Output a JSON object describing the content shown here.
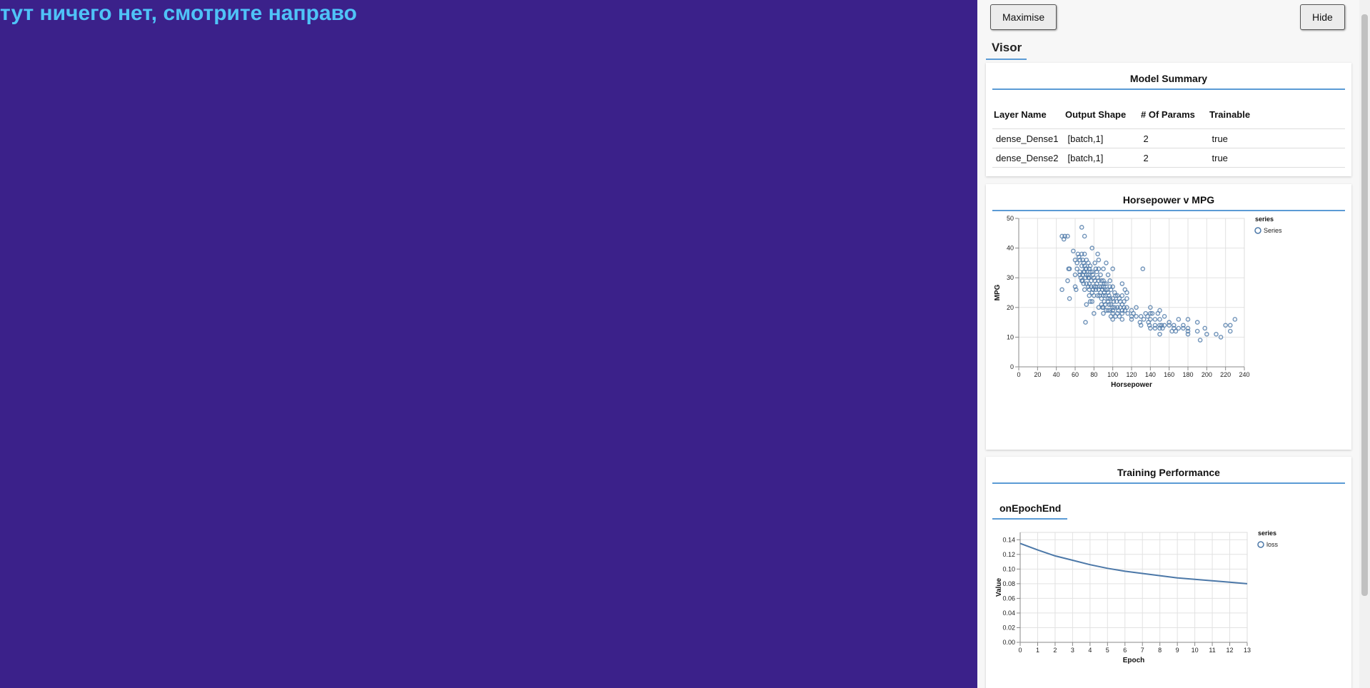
{
  "main": {
    "heading": "тут ничего нет, смотрите направо"
  },
  "visor": {
    "maximise_label": "Maximise",
    "hide_label": "Hide",
    "tab_label": "Visor",
    "summary": {
      "title": "Model Summary",
      "headers": [
        "Layer Name",
        "Output Shape",
        "# Of Params",
        "Trainable"
      ],
      "rows": [
        [
          "dense_Dense1",
          "[batch,1]",
          "2",
          "true"
        ],
        [
          "dense_Dense2",
          "[batch,1]",
          "2",
          "true"
        ]
      ]
    },
    "hp_title": "Horsepower v MPG",
    "training": {
      "title": "Training Performance",
      "tab_label": "onEpochEnd"
    }
  },
  "chart_data": [
    {
      "type": "scatter",
      "title": "Horsepower v MPG",
      "xlabel": "Horsepower",
      "ylabel": "MPG",
      "xlim": [
        0,
        240
      ],
      "ylim": [
        0,
        50
      ],
      "x_ticks": [
        "0",
        "20",
        "40",
        "60",
        "80",
        "100",
        "120",
        "140",
        "160",
        "180",
        "200",
        "220",
        "240"
      ],
      "y_ticks": [
        "0",
        "10",
        "20",
        "30",
        "40",
        "50"
      ],
      "legend_title": "series",
      "legend_position": "top-right",
      "grid": true,
      "color": "#4c78a8",
      "series": [
        {
          "name": "Series",
          "points": [
            [
              46,
              26
            ],
            [
              46,
              44
            ],
            [
              48,
              43
            ],
            [
              49,
              44
            ],
            [
              52,
              44
            ],
            [
              52,
              29
            ],
            [
              53,
              33
            ],
            [
              54,
              33
            ],
            [
              54,
              23
            ],
            [
              58,
              39
            ],
            [
              60,
              36
            ],
            [
              60,
              31
            ],
            [
              60,
              27
            ],
            [
              61,
              26
            ],
            [
              62,
              35
            ],
            [
              62,
              33
            ],
            [
              63,
              38
            ],
            [
              64,
              37
            ],
            [
              65,
              31
            ],
            [
              65,
              36
            ],
            [
              65,
              32
            ],
            [
              66,
              30
            ],
            [
              67,
              47
            ],
            [
              67,
              38
            ],
            [
              67,
              34
            ],
            [
              67,
              29
            ],
            [
              68,
              36
            ],
            [
              68,
              31
            ],
            [
              68,
              29
            ],
            [
              69,
              35
            ],
            [
              69,
              32
            ],
            [
              69,
              28
            ],
            [
              70,
              44
            ],
            [
              70,
              38
            ],
            [
              70,
              34
            ],
            [
              70,
              32
            ],
            [
              70,
              26
            ],
            [
              71,
              33
            ],
            [
              71,
              30
            ],
            [
              71,
              15
            ],
            [
              72,
              36
            ],
            [
              72,
              33
            ],
            [
              72,
              31
            ],
            [
              72,
              28
            ],
            [
              72,
              21
            ],
            [
              74,
              35
            ],
            [
              74,
              31
            ],
            [
              74,
              30
            ],
            [
              74,
              27
            ],
            [
              75,
              33
            ],
            [
              75,
              30
            ],
            [
              75,
              28
            ],
            [
              75,
              26
            ],
            [
              75,
              24
            ],
            [
              76,
              34
            ],
            [
              76,
              32
            ],
            [
              76,
              22
            ],
            [
              77,
              29
            ],
            [
              77,
              27
            ],
            [
              78,
              40
            ],
            [
              78,
              32
            ],
            [
              78,
              25
            ],
            [
              78,
              22
            ],
            [
              79,
              31
            ],
            [
              79,
              26
            ],
            [
              80,
              30
            ],
            [
              80,
              27
            ],
            [
              80,
              24
            ],
            [
              80,
              18
            ],
            [
              81,
              35
            ],
            [
              81,
              29
            ],
            [
              82,
              33
            ],
            [
              82,
              27
            ],
            [
              82,
              26
            ],
            [
              83,
              32
            ],
            [
              83,
              28
            ],
            [
              84,
              38
            ],
            [
              84,
              30
            ],
            [
              84,
              24
            ],
            [
              85,
              36
            ],
            [
              85,
              33
            ],
            [
              85,
              29
            ],
            [
              85,
              26
            ],
            [
              85,
              20
            ],
            [
              86,
              27
            ],
            [
              86,
              24
            ],
            [
              87,
              31
            ],
            [
              87,
              25
            ],
            [
              88,
              29
            ],
            [
              88,
              27
            ],
            [
              88,
              23
            ],
            [
              88,
              21
            ],
            [
              89,
              26
            ],
            [
              89,
              20
            ],
            [
              90,
              33
            ],
            [
              90,
              29
            ],
            [
              90,
              27
            ],
            [
              90,
              24
            ],
            [
              90,
              20
            ],
            [
              90,
              18
            ],
            [
              91,
              28
            ],
            [
              91,
              25
            ],
            [
              91,
              22
            ],
            [
              92,
              26
            ],
            [
              92,
              24
            ],
            [
              92,
              21
            ],
            [
              93,
              35
            ],
            [
              93,
              28
            ],
            [
              93,
              19
            ],
            [
              94,
              26
            ],
            [
              95,
              31
            ],
            [
              95,
              25
            ],
            [
              95,
              23
            ],
            [
              95,
              22
            ],
            [
              95,
              19
            ],
            [
              96,
              24
            ],
            [
              96,
              21
            ],
            [
              97,
              29
            ],
            [
              97,
              27
            ],
            [
              97,
              23
            ],
            [
              97,
              19
            ],
            [
              98,
              26
            ],
            [
              98,
              21
            ],
            [
              98,
              17
            ],
            [
              100,
              33
            ],
            [
              100,
              27
            ],
            [
              100,
              23
            ],
            [
              100,
              20
            ],
            [
              100,
              19
            ],
            [
              100,
              18
            ],
            [
              100,
              16
            ],
            [
              101,
              22
            ],
            [
              102,
              25
            ],
            [
              102,
              20
            ],
            [
              103,
              24
            ],
            [
              103,
              17
            ],
            [
              104,
              22
            ],
            [
              105,
              24
            ],
            [
              105,
              20
            ],
            [
              105,
              18
            ],
            [
              106,
              19
            ],
            [
              107,
              23
            ],
            [
              107,
              17
            ],
            [
              108,
              22
            ],
            [
              108,
              20
            ],
            [
              110,
              28
            ],
            [
              110,
              24
            ],
            [
              110,
              21
            ],
            [
              110,
              19
            ],
            [
              110,
              18
            ],
            [
              110,
              16
            ],
            [
              112,
              22
            ],
            [
              112,
              20
            ],
            [
              113,
              26
            ],
            [
              113,
              19
            ],
            [
              115,
              25
            ],
            [
              115,
              23
            ],
            [
              115,
              20
            ],
            [
              116,
              18
            ],
            [
              120,
              19
            ],
            [
              120,
              17
            ],
            [
              120,
              16
            ],
            [
              122,
              18
            ],
            [
              125,
              20
            ],
            [
              125,
              17
            ],
            [
              129,
              15
            ],
            [
              130,
              17
            ],
            [
              130,
              14
            ],
            [
              132,
              33
            ],
            [
              133,
              16
            ],
            [
              135,
              18
            ],
            [
              137,
              17
            ],
            [
              138,
              15
            ],
            [
              139,
              14
            ],
            [
              140,
              20
            ],
            [
              140,
              18
            ],
            [
              140,
              16
            ],
            [
              140,
              13
            ],
            [
              142,
              18
            ],
            [
              145,
              16
            ],
            [
              145,
              14
            ],
            [
              145,
              13
            ],
            [
              148,
              18
            ],
            [
              150,
              19
            ],
            [
              150,
              16
            ],
            [
              150,
              14
            ],
            [
              150,
              13
            ],
            [
              150,
              11
            ],
            [
              152,
              14
            ],
            [
              153,
              13
            ],
            [
              155,
              17
            ],
            [
              155,
              14
            ],
            [
              160,
              15
            ],
            [
              160,
              14
            ],
            [
              163,
              12
            ],
            [
              165,
              14
            ],
            [
              165,
              13
            ],
            [
              167,
              12
            ],
            [
              170,
              16
            ],
            [
              170,
              13
            ],
            [
              175,
              14
            ],
            [
              175,
              13
            ],
            [
              180,
              16
            ],
            [
              180,
              13
            ],
            [
              180,
              12
            ],
            [
              180,
              11
            ],
            [
              190,
              15
            ],
            [
              190,
              12
            ],
            [
              193,
              9
            ],
            [
              198,
              13
            ],
            [
              200,
              11
            ],
            [
              210,
              11
            ],
            [
              215,
              10
            ],
            [
              220,
              14
            ],
            [
              225,
              14
            ],
            [
              225,
              12
            ],
            [
              230,
              16
            ]
          ]
        }
      ]
    },
    {
      "type": "line",
      "title": "",
      "xlabel": "Epoch",
      "ylabel": "Value",
      "xlim": [
        0,
        13
      ],
      "ylim": [
        0,
        0.15
      ],
      "x_ticks": [
        "0",
        "1",
        "2",
        "3",
        "4",
        "5",
        "6",
        "7",
        "8",
        "9",
        "10",
        "11",
        "12",
        "13"
      ],
      "y_ticks": [
        "0.00",
        "0.02",
        "0.04",
        "0.06",
        "0.08",
        "0.10",
        "0.12",
        "0.14"
      ],
      "legend_title": "series",
      "legend_position": "top-right",
      "grid": true,
      "color": "#4c78a8",
      "series": [
        {
          "name": "loss",
          "x": [
            0,
            1,
            2,
            3,
            4,
            5,
            6,
            7,
            8,
            9,
            10,
            11,
            12,
            13
          ],
          "values": [
            0.135,
            0.126,
            0.118,
            0.112,
            0.106,
            0.101,
            0.097,
            0.094,
            0.091,
            0.088,
            0.086,
            0.084,
            0.082,
            0.08
          ]
        }
      ]
    }
  ]
}
